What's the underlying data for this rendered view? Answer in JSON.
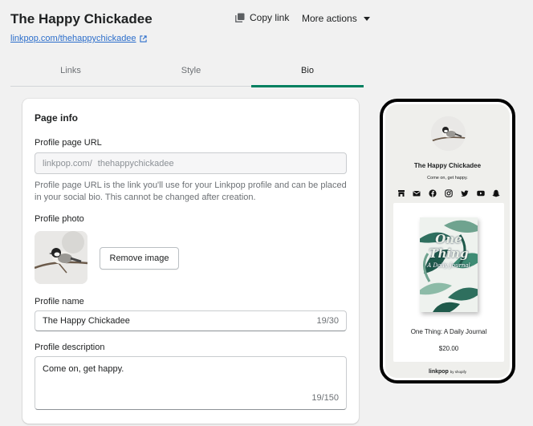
{
  "header": {
    "title": "The Happy Chickadee",
    "url": "linkpop.com/thehappychickadee",
    "copy_link": "Copy link",
    "more_actions": "More actions"
  },
  "tabs": [
    {
      "label": "Links",
      "active": false
    },
    {
      "label": "Style",
      "active": false
    },
    {
      "label": "Bio",
      "active": true
    }
  ],
  "page_info": {
    "title": "Page info",
    "profile_url_label": "Profile page URL",
    "url_prefix": "linkpop.com/",
    "url_slug": "thehappychickadee",
    "url_help": "Profile page URL is the link you'll use for your Linkpop profile and can be placed in your social bio. This cannot be changed after creation.",
    "profile_photo_label": "Profile photo",
    "remove_image": "Remove image",
    "profile_name_label": "Profile name",
    "profile_name_value": "The Happy Chickadee",
    "profile_name_count": "19/30",
    "profile_desc_label": "Profile description",
    "profile_desc_value": "Come on, get happy.",
    "profile_desc_count": "19/150"
  },
  "preview": {
    "name": "The Happy Chickadee",
    "description": "Come on, get happy.",
    "socials": [
      "shop-icon",
      "email-icon",
      "facebook-icon",
      "instagram-icon",
      "twitter-icon",
      "youtube-icon",
      "snapchat-icon"
    ],
    "product_title": "One Thing: A Daily Journal",
    "product_price": "$20.00",
    "book_title_line1": "One",
    "book_title_line2": "Thing",
    "book_subtitle": "A Daily Journal",
    "footer_logo": "linkpop",
    "footer_by": "by shopify"
  },
  "colors": {
    "accent": "#008060",
    "link": "#2c6ecb",
    "background": "#f1f1f1"
  }
}
